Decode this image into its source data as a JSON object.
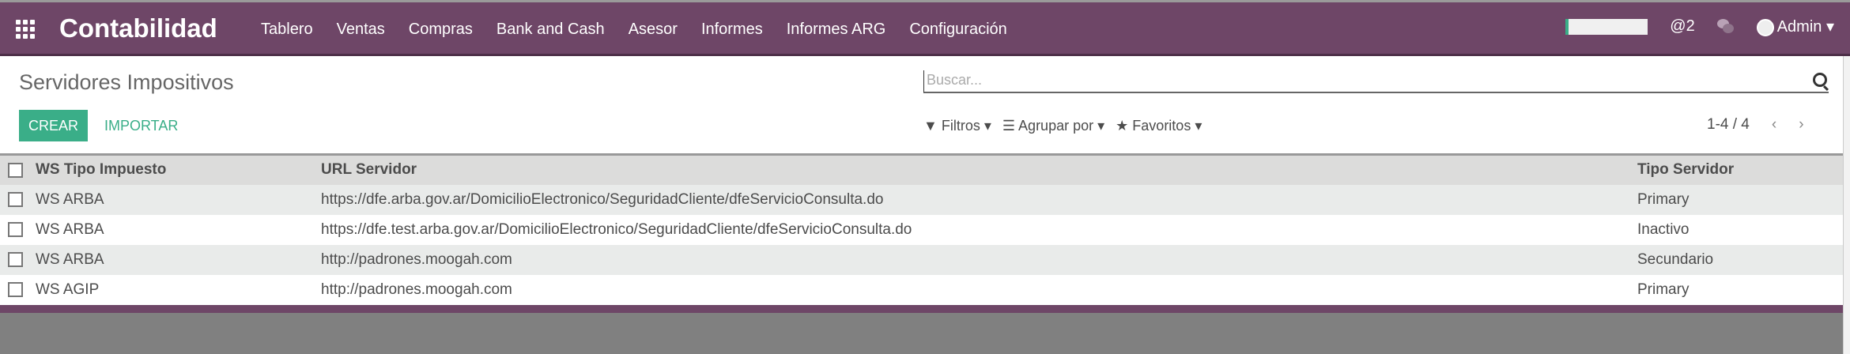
{
  "navbar": {
    "brand": "Contabilidad",
    "menu": [
      "Tablero",
      "Ventas",
      "Compras",
      "Bank and Cash",
      "Asesor",
      "Informes",
      "Informes ARG",
      "Configuración"
    ],
    "mentions": "@2",
    "user": "Admin ▾"
  },
  "page": {
    "title": "Servidores Impositivos",
    "search_placeholder": "Buscar...",
    "create": "CREAR",
    "import": "IMPORTAR",
    "filters": "Filtros ▾",
    "group_by": "Agrupar por ▾",
    "favorites": "Favoritos ▾",
    "pager": "1-4 / 4",
    "prev": "‹",
    "next": "›"
  },
  "table": {
    "columns": [
      "WS Tipo Impuesto",
      "URL Servidor",
      "Tipo Servidor"
    ],
    "rows": [
      [
        "WS ARBA",
        "https://dfe.arba.gov.ar/DomicilioElectronico/SeguridadCliente/dfeServicioConsulta.do",
        "Primary"
      ],
      [
        "WS ARBA",
        "https://dfe.test.arba.gov.ar/DomicilioElectronico/SeguridadCliente/dfeServicioConsulta.do",
        "Inactivo"
      ],
      [
        "WS ARBA",
        "http://padrones.moogah.com",
        "Secundario"
      ],
      [
        "WS AGIP",
        "http://padrones.moogah.com",
        "Primary"
      ]
    ]
  },
  "colors": {
    "navbar": "#6e4667",
    "accent": "#3aae88"
  }
}
